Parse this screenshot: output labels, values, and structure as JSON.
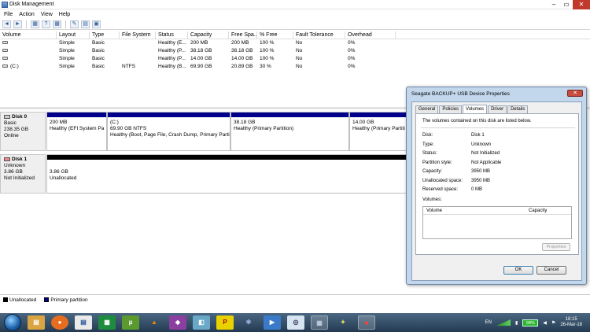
{
  "window": {
    "title": "Disk Management"
  },
  "menu": [
    "File",
    "Action",
    "View",
    "Help"
  ],
  "toolbar": {
    "icons": [
      "back-icon",
      "forward-icon",
      "grid-icon",
      "help-icon",
      "grid2-icon",
      "settings-icon",
      "folder-icon",
      "properties-icon"
    ]
  },
  "columns": [
    "Volume",
    "Layout",
    "Type",
    "File System",
    "Status",
    "Capacity",
    "Free Spa...",
    "% Free",
    "Fault Tolerance",
    "Overhead"
  ],
  "rows": [
    [
      "",
      "Simple",
      "Basic",
      "",
      "Healthy (E...",
      "200 MB",
      "200 MB",
      "100 %",
      "No",
      "0%"
    ],
    [
      "",
      "Simple",
      "Basic",
      "",
      "Healthy (P...",
      "38.18 GB",
      "38.18 GB",
      "100 %",
      "No",
      "0%"
    ],
    [
      "",
      "Simple",
      "Basic",
      "",
      "Healthy (P...",
      "14.00 GB",
      "14.00 GB",
      "100 %",
      "No",
      "0%"
    ],
    [
      "(C:)",
      "Simple",
      "Basic",
      "NTFS",
      "Healthy (B...",
      "69.90 GB",
      "20.89 GB",
      "30 %",
      "No",
      "0%"
    ]
  ],
  "disk0": {
    "name": "Disk 0",
    "type": "Basic",
    "size": "238.35 GB",
    "status": "Online",
    "parts": [
      {
        "name": "",
        "size": "200 MB",
        "status": "Healthy (EFI System Pa"
      },
      {
        "name": "(C:)",
        "size": "69.90 GB NTFS",
        "status": "Healthy (Boot, Page File, Crash Dump, Primary Partiti"
      },
      {
        "name": "",
        "size": "38.18 GB",
        "status": "Healthy (Primary Partition)"
      },
      {
        "name": "",
        "size": "14.00 GB",
        "status": "Healthy (Primary Partiti"
      }
    ]
  },
  "disk1": {
    "name": "Disk 1",
    "type": "Unknown",
    "size": "3.86 GB",
    "status": "Not Initialized",
    "part": {
      "size": "3.86 GB",
      "status": "Unallocated"
    }
  },
  "legend": {
    "unallocated": "Unallocated",
    "primary": "Primary partition"
  },
  "dialog": {
    "title": "Seagate BACKUP+ USB Device Properties",
    "close": "✕",
    "tabs": [
      "General",
      "Policies",
      "Volumes",
      "Driver",
      "Details"
    ],
    "intro": "The volumes contained on this disk are listed below.",
    "props": [
      {
        "k": "Disk:",
        "v": "Disk 1"
      },
      {
        "k": "Type:",
        "v": "Unknown"
      },
      {
        "k": "Status:",
        "v": "Not Initialized"
      },
      {
        "k": "Partition style:",
        "v": "Not Applicable"
      },
      {
        "k": "Capacity:",
        "v": "3950 MB"
      },
      {
        "k": "Unallocated space:",
        "v": "3950 MB"
      },
      {
        "k": "Reserved space:",
        "v": "0 MB"
      }
    ],
    "volumes_label": "Volumes:",
    "vol_cols": [
      "Volume",
      "Capacity"
    ],
    "properties_btn": "Properties",
    "ok": "OK",
    "cancel": "Cancel"
  },
  "taskbar": {
    "lang": "EN",
    "battery": "98%",
    "time": "18:15",
    "date": "26-Mar-18"
  }
}
